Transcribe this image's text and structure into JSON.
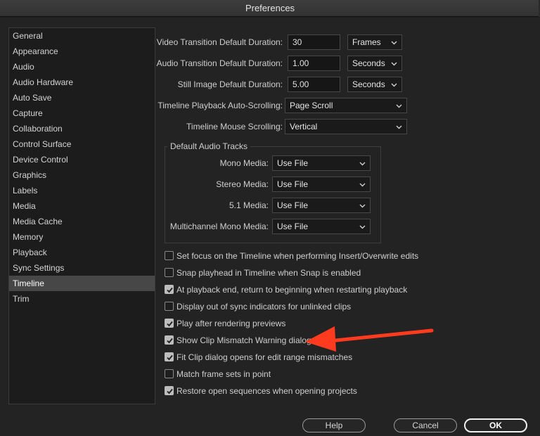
{
  "window": {
    "title": "Preferences"
  },
  "sidebar": {
    "items": [
      {
        "label": "General"
      },
      {
        "label": "Appearance"
      },
      {
        "label": "Audio"
      },
      {
        "label": "Audio Hardware"
      },
      {
        "label": "Auto Save"
      },
      {
        "label": "Capture"
      },
      {
        "label": "Collaboration"
      },
      {
        "label": "Control Surface"
      },
      {
        "label": "Device Control"
      },
      {
        "label": "Graphics"
      },
      {
        "label": "Labels"
      },
      {
        "label": "Media"
      },
      {
        "label": "Media Cache"
      },
      {
        "label": "Memory"
      },
      {
        "label": "Playback"
      },
      {
        "label": "Sync Settings"
      },
      {
        "label": "Timeline"
      },
      {
        "label": "Trim"
      }
    ],
    "selected": "Timeline"
  },
  "settings": {
    "video_transition": {
      "label": "Video Transition Default Duration:",
      "value": "30",
      "unit": "Frames"
    },
    "audio_transition": {
      "label": "Audio Transition Default Duration:",
      "value": "1.00",
      "unit": "Seconds"
    },
    "still_image": {
      "label": "Still Image Default Duration:",
      "value": "5.00",
      "unit": "Seconds"
    },
    "playback_scrolling": {
      "label": "Timeline Playback Auto-Scrolling:",
      "value": "Page Scroll"
    },
    "mouse_scrolling": {
      "label": "Timeline Mouse Scrolling:",
      "value": "Vertical"
    }
  },
  "audio_tracks": {
    "title": "Default Audio Tracks",
    "mono": {
      "label": "Mono Media:",
      "value": "Use File"
    },
    "stereo": {
      "label": "Stereo Media:",
      "value": "Use File"
    },
    "surround": {
      "label": "5.1 Media:",
      "value": "Use File"
    },
    "multichannel": {
      "label": "Multichannel Mono Media:",
      "value": "Use File"
    }
  },
  "checkboxes": [
    {
      "label": "Set focus on the Timeline when performing Insert/Overwrite edits",
      "checked": false
    },
    {
      "label": "Snap playhead in Timeline when Snap is enabled",
      "checked": false
    },
    {
      "label": "At playback end, return to beginning when restarting playback",
      "checked": true
    },
    {
      "label": "Display out of sync indicators for unlinked clips",
      "checked": false
    },
    {
      "label": "Play after rendering previews",
      "checked": true
    },
    {
      "label": "Show Clip Mismatch Warning dialog",
      "checked": true
    },
    {
      "label": "Fit Clip dialog opens for edit range mismatches",
      "checked": true
    },
    {
      "label": "Match frame sets in point",
      "checked": false
    },
    {
      "label": "Restore open sequences when opening projects",
      "checked": true
    }
  ],
  "buttons": {
    "help": "Help",
    "cancel": "Cancel",
    "ok": "OK"
  },
  "annotation": {
    "color": "#ff3b1f"
  }
}
